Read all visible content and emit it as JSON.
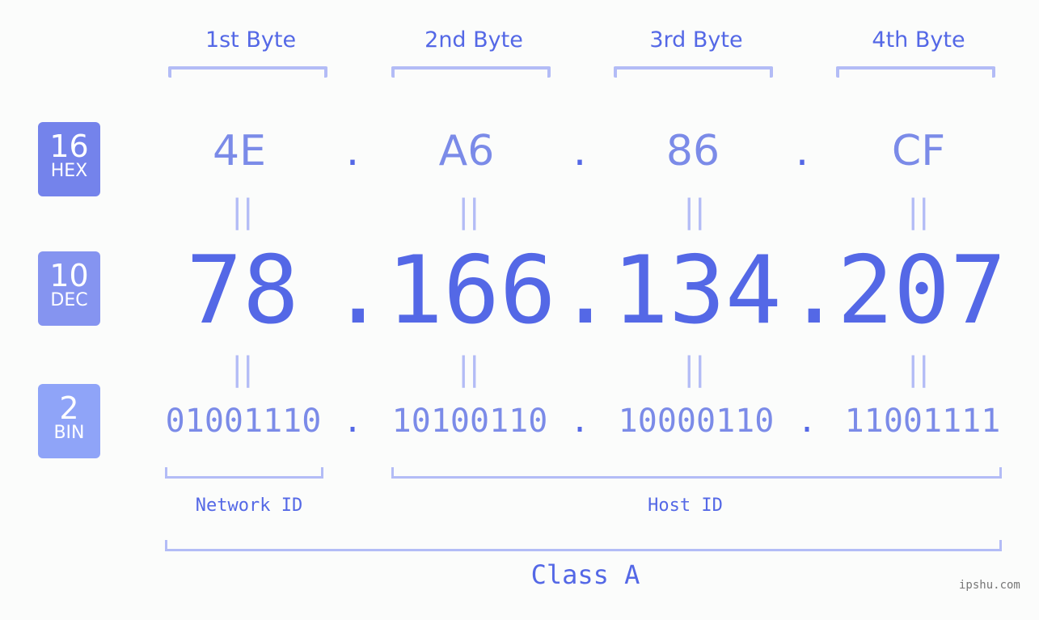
{
  "bytes": [
    {
      "label": "1st Byte",
      "hex": "4E",
      "dec": "78",
      "bin": "01001110"
    },
    {
      "label": "2nd Byte",
      "hex": "A6",
      "dec": "166",
      "bin": "10100110"
    },
    {
      "label": "3rd Byte",
      "hex": "86",
      "dec": "134",
      "bin": "10000110"
    },
    {
      "label": "4th Byte",
      "hex": "CF",
      "dec": "207",
      "bin": "11001111"
    }
  ],
  "separator": ".",
  "equals_symbol": "||",
  "badges": {
    "hex": {
      "base": "16",
      "name": "HEX",
      "color": "#7483eb"
    },
    "dec": {
      "base": "10",
      "name": "DEC",
      "color": "#8594f0"
    },
    "bin": {
      "base": "2",
      "name": "BIN",
      "color": "#8fa4f8"
    }
  },
  "network_label": "Network ID",
  "host_label": "Host ID",
  "class_label": "Class A",
  "watermark": "ipshu.com",
  "colors": {
    "accent": "#5468e6",
    "light": "#7b8be8",
    "bracket": "#b3bcf6"
  }
}
